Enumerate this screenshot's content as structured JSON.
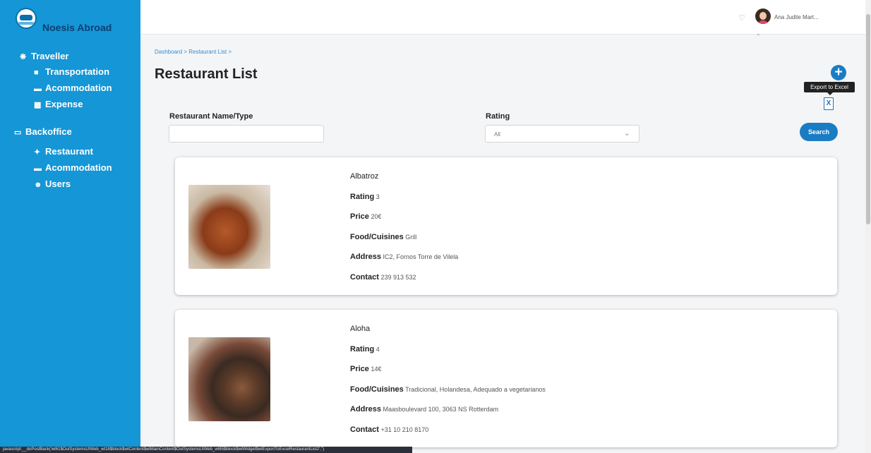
{
  "app": {
    "name": "Noesis Abroad"
  },
  "header": {
    "user_name": "Ana Judite Mart..."
  },
  "sidebar": {
    "traveller": {
      "label": "Traveller",
      "items": [
        "Transportation",
        "Acommodation",
        "Expense"
      ]
    },
    "backoffice": {
      "label": "Backoffice",
      "items": [
        "Restaurant",
        "Acommodation",
        "Users"
      ]
    }
  },
  "breadcrumb": {
    "items": [
      "Dashboard",
      "Restaurant List"
    ]
  },
  "page": {
    "title": "Restaurant List",
    "export_tooltip": "Export to Excel",
    "excel_icon_text": "X"
  },
  "filters": {
    "name_label": "Restaurant Name/Type",
    "name_value": "",
    "rating_label": "Rating",
    "rating_value": "All",
    "search_label": "Search"
  },
  "field_labels": {
    "rating": "Rating",
    "price": "Price",
    "food": "Food/Cuisines",
    "address": "Address",
    "contact": "Contact"
  },
  "restaurants": [
    {
      "name": "Albatroz",
      "rating": "3",
      "price": "20€",
      "food": "Grill",
      "address": "IC2, Fornos Torre de Vilela",
      "contact": "239 913 532"
    },
    {
      "name": "Aloha",
      "rating": "4",
      "price": "14€",
      "food": "Tradicional, Holandesa,  Adequado a vegetarianos",
      "address": "Maasboulevard 100, 3063 NS Rotterdam",
      "contact": "+31 10 210 8170"
    }
  ],
  "status_bar": "javascript:__doPostBack('wt61$OutSystemsUIWeb_wt18$block$wtContent$wtMainContent$OutSystemsUIWeb_wt65$block$wtWidget$wtExportToExcelRestaurantList2','')",
  "colors": {
    "sidebar": "#1596d6",
    "accent": "#1a7dc4",
    "brand_text": "#0b3f72"
  }
}
